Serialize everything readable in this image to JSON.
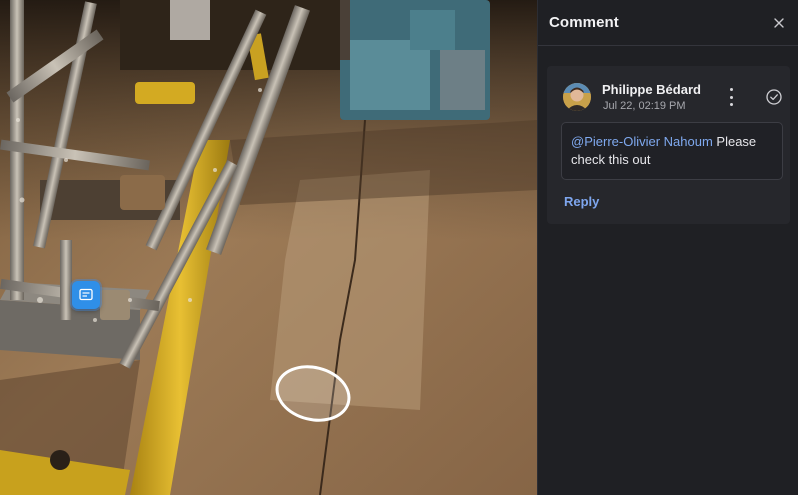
{
  "panel": {
    "title": "Comment",
    "close_icon": "close-icon"
  },
  "comment": {
    "author": "Philippe Bédard",
    "timestamp": "Jul 22, 02:19 PM",
    "mention": "@Pierre-Olivier Nahoum",
    "text": " Please check this out",
    "reply_label": "Reply",
    "more_icon": "more-vertical-icon",
    "resolve_icon": "check-circle-icon"
  },
  "viewport": {
    "pin_icon": "annotation-pin-icon",
    "shape": "ellipse-markup"
  },
  "colors": {
    "panel_bg": "#1f2024",
    "card_bg": "#26272c",
    "accent": "#7ea6ee",
    "pin": "#2f8fe8"
  }
}
